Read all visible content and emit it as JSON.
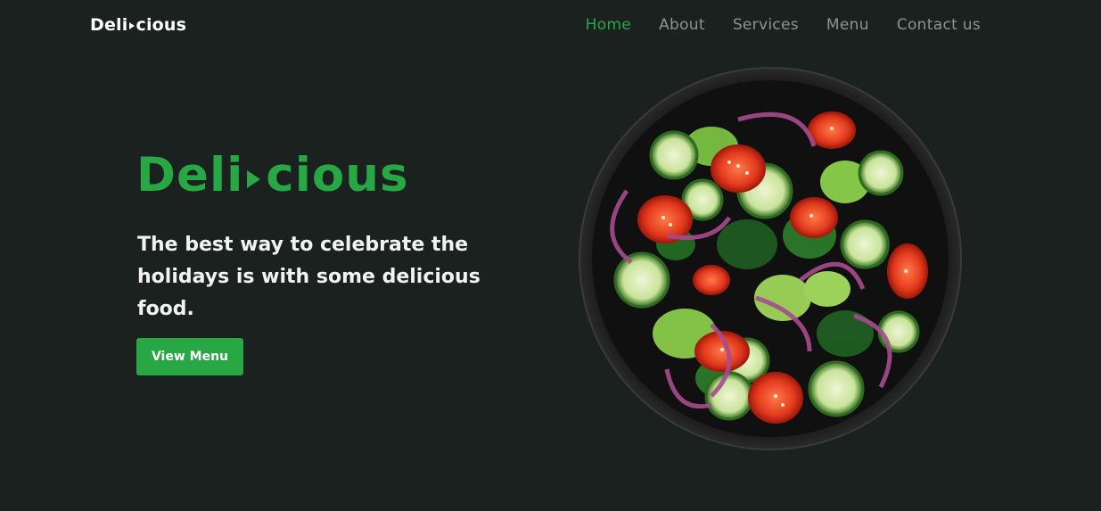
{
  "nav": {
    "logo_left": "Deli",
    "logo_right": "cious",
    "links": [
      {
        "label": "Home",
        "active": true
      },
      {
        "label": "About",
        "active": false
      },
      {
        "label": "Services",
        "active": false
      },
      {
        "label": "Menu",
        "active": false
      },
      {
        "label": "Contact us",
        "active": false
      }
    ]
  },
  "hero": {
    "title_left": "Deli",
    "title_right": "cious",
    "subtitle": "The best way to celebrate the holidays is with some delicious food.",
    "button_label": "View Menu",
    "image_icon": "salad-bowl-image"
  },
  "colors": {
    "background": "#1b211f",
    "accent": "#28a745",
    "nav_inactive": "#8d9490",
    "text": "#ffffff"
  }
}
